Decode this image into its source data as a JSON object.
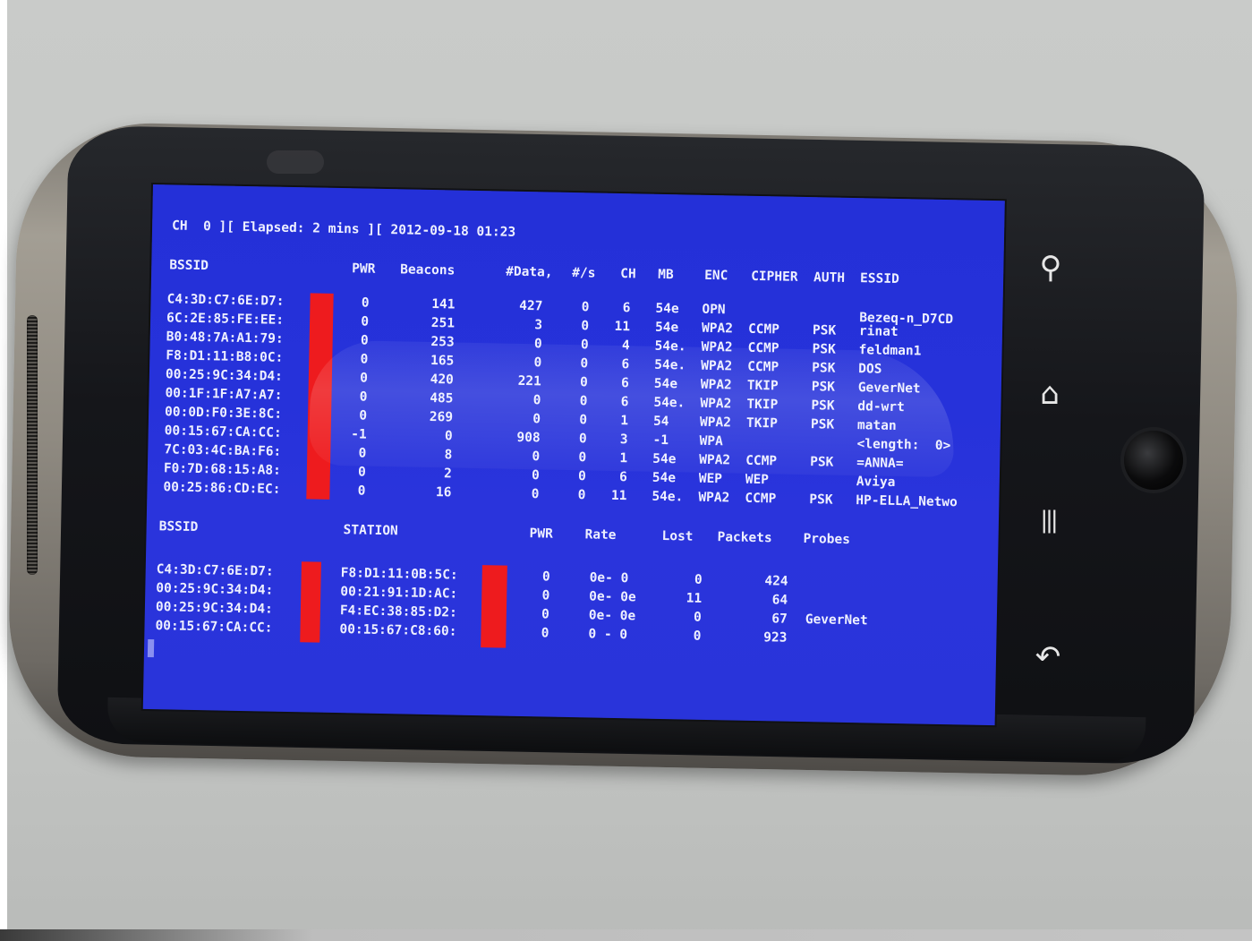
{
  "header": "CH  0 ][ Elapsed: 2 mins ][ 2012-09-18 01:23",
  "ap_columns": [
    "BSSID",
    "PWR",
    "Beacons",
    "#Data,",
    "#/s",
    "CH",
    "MB",
    "ENC",
    "CIPHER",
    "AUTH",
    "ESSID"
  ],
  "ap_rows": [
    {
      "bssid": "C4:3D:C7:6E:D7:",
      "pwr": "0",
      "beacons": "141",
      "data": "427",
      "ps": "0",
      "ch": "6",
      "mb": "54e",
      "enc": "OPN",
      "cipher": "",
      "auth": "",
      "essid": "Bezeq-n_D7CD"
    },
    {
      "bssid": "6C:2E:85:FE:EE:",
      "pwr": "0",
      "beacons": "251",
      "data": "3",
      "ps": "0",
      "ch": "11",
      "mb": "54e",
      "enc": "WPA2",
      "cipher": "CCMP",
      "auth": "PSK",
      "essid": "rinat"
    },
    {
      "bssid": "B0:48:7A:A1:79:",
      "pwr": "0",
      "beacons": "253",
      "data": "0",
      "ps": "0",
      "ch": "4",
      "mb": "54e.",
      "enc": "WPA2",
      "cipher": "CCMP",
      "auth": "PSK",
      "essid": "feldman1"
    },
    {
      "bssid": "F8:D1:11:B8:0C:",
      "pwr": "0",
      "beacons": "165",
      "data": "0",
      "ps": "0",
      "ch": "6",
      "mb": "54e.",
      "enc": "WPA2",
      "cipher": "CCMP",
      "auth": "PSK",
      "essid": "DOS"
    },
    {
      "bssid": "00:25:9C:34:D4:",
      "pwr": "0",
      "beacons": "420",
      "data": "221",
      "ps": "0",
      "ch": "6",
      "mb": "54e",
      "enc": "WPA2",
      "cipher": "TKIP",
      "auth": "PSK",
      "essid": "GeverNet"
    },
    {
      "bssid": "00:1F:1F:A7:A7:",
      "pwr": "0",
      "beacons": "485",
      "data": "0",
      "ps": "0",
      "ch": "6",
      "mb": "54e.",
      "enc": "WPA2",
      "cipher": "TKIP",
      "auth": "PSK",
      "essid": "dd-wrt"
    },
    {
      "bssid": "00:0D:F0:3E:8C:",
      "pwr": "0",
      "beacons": "269",
      "data": "0",
      "ps": "0",
      "ch": "1",
      "mb": "54",
      "enc": "WPA2",
      "cipher": "TKIP",
      "auth": "PSK",
      "essid": "matan"
    },
    {
      "bssid": "00:15:67:CA:CC:",
      "pwr": "-1",
      "beacons": "0",
      "data": "908",
      "ps": "0",
      "ch": "3",
      "mb": "-1",
      "enc": "WPA",
      "cipher": "",
      "auth": "",
      "essid": "<length:  0>"
    },
    {
      "bssid": "7C:03:4C:BA:F6:",
      "pwr": "0",
      "beacons": "8",
      "data": "0",
      "ps": "0",
      "ch": "1",
      "mb": "54e",
      "enc": "WPA2",
      "cipher": "CCMP",
      "auth": "PSK",
      "essid": "=ANNA="
    },
    {
      "bssid": "F0:7D:68:15:A8:",
      "pwr": "0",
      "beacons": "2",
      "data": "0",
      "ps": "0",
      "ch": "6",
      "mb": "54e",
      "enc": "WEP",
      "cipher": "WEP",
      "auth": "",
      "essid": "Aviya"
    },
    {
      "bssid": "00:25:86:CD:EC:",
      "pwr": "0",
      "beacons": "16",
      "data": "0",
      "ps": "0",
      "ch": "11",
      "mb": "54e.",
      "enc": "WPA2",
      "cipher": "CCMP",
      "auth": "PSK",
      "essid": "HP-ELLA_Netwo"
    }
  ],
  "station_columns": [
    "BSSID",
    "STATION",
    "PWR",
    "Rate",
    "Lost",
    "Packets",
    "Probes"
  ],
  "station_rows": [
    {
      "bssid": "C4:3D:C7:6E:D7:",
      "station": "F8:D1:11:0B:5C:",
      "pwr": "0",
      "rate": "0e- 0",
      "lost": "0",
      "packets": "424",
      "probes": ""
    },
    {
      "bssid": "00:25:9C:34:D4:",
      "station": "00:21:91:1D:AC:",
      "pwr": "0",
      "rate": "0e- 0e",
      "lost": "11",
      "packets": "64",
      "probes": ""
    },
    {
      "bssid": "00:25:9C:34:D4:",
      "station": "F4:EC:38:85:D2:",
      "pwr": "0",
      "rate": "0e- 0e",
      "lost": "0",
      "packets": "67",
      "probes": "GeverNet"
    },
    {
      "bssid": "00:15:67:CA:CC:",
      "station": "00:15:67:C8:60:",
      "pwr": "0",
      "rate": "0 - 0",
      "lost": "0",
      "packets": "923",
      "probes": ""
    }
  ],
  "hardware_keys": [
    {
      "name": "search-icon",
      "glyph": "⚲"
    },
    {
      "name": "home-icon",
      "glyph": "⌂"
    },
    {
      "name": "menu-icon",
      "glyph": "|||"
    },
    {
      "name": "back-icon",
      "glyph": "↶"
    }
  ],
  "colors": {
    "screen": "#2632da",
    "text": "#eef0ff",
    "redaction": "#ee1b1e"
  }
}
